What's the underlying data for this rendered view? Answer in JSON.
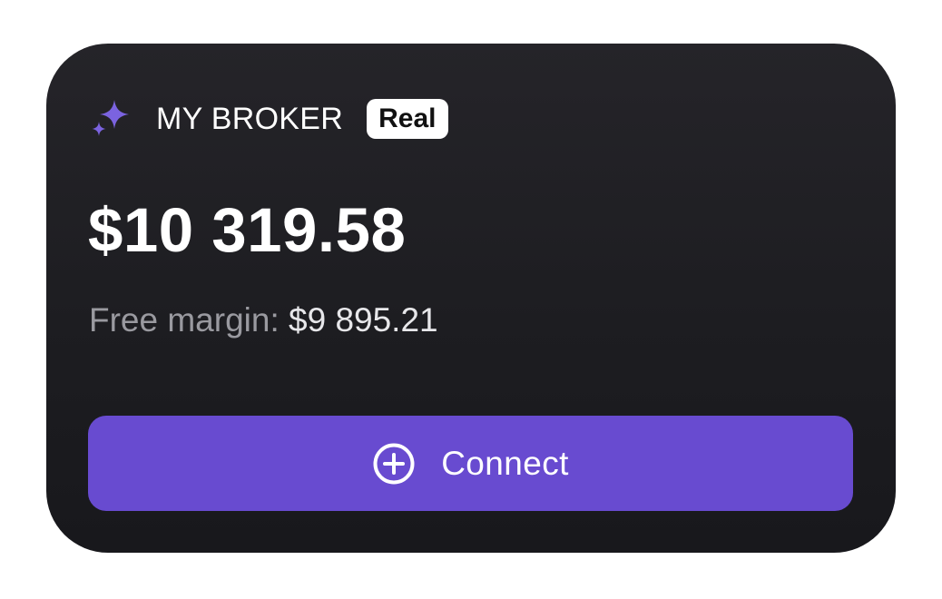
{
  "broker": {
    "name": "MY BROKER",
    "badge": "Real",
    "icon": "sparkle-icon",
    "icon_color": "#7b63e0"
  },
  "account": {
    "balance": "$10 319.58",
    "free_margin_label": "Free margin:",
    "free_margin_value": "$9 895.21"
  },
  "actions": {
    "connect_label": "Connect",
    "connect_icon": "plus-circle-icon",
    "button_color": "#684bd0"
  }
}
